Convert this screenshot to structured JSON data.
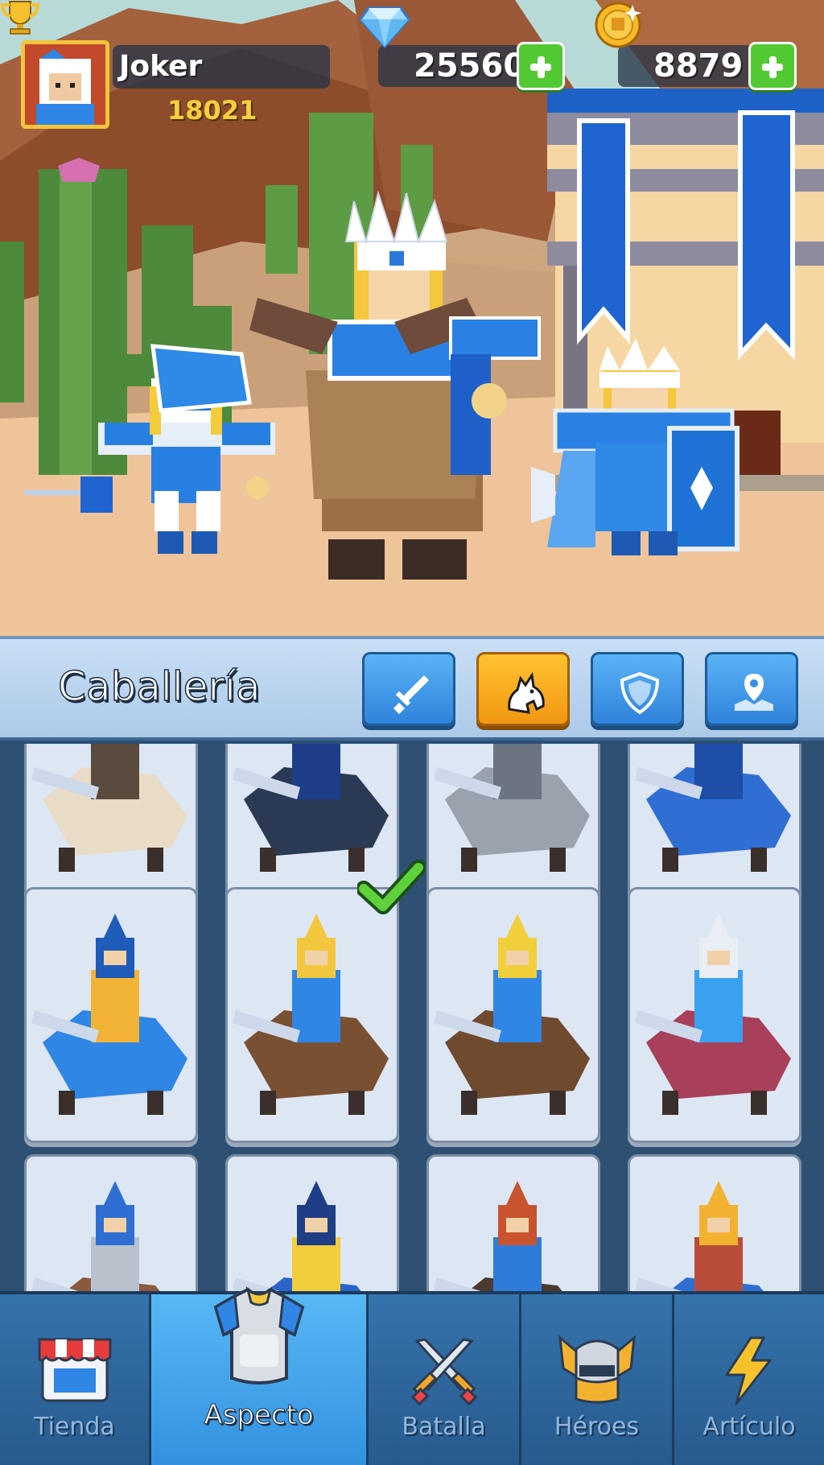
{
  "player": {
    "name": "Joker",
    "trophies": "18021"
  },
  "currency": {
    "gems": "25560",
    "coins": "8879"
  },
  "category": {
    "title": "Caballería",
    "tabs": [
      {
        "icon": "sword-icon",
        "active": false
      },
      {
        "icon": "horse-icon",
        "active": true
      },
      {
        "icon": "shield-icon",
        "active": false
      },
      {
        "icon": "map-pin-icon",
        "active": false
      }
    ]
  },
  "skins": {
    "selected_index": 5,
    "items": [
      {
        "icon": "white-beast-mount"
      },
      {
        "icon": "black-dragon-mount"
      },
      {
        "icon": "grey-wolf-mount"
      },
      {
        "icon": "blue-dragon-mount"
      },
      {
        "icon": "blue-bird-knight"
      },
      {
        "icon": "horned-beast-knight"
      },
      {
        "icon": "yellow-armored-knight"
      },
      {
        "icon": "boar-viking-rider"
      },
      {
        "icon": "grey-winged-rider"
      },
      {
        "icon": "blue-wyvern-rider"
      },
      {
        "icon": "red-hair-cavalier"
      },
      {
        "icon": "stag-wizard-rider"
      }
    ]
  },
  "nav": {
    "items": [
      {
        "label": "Tienda",
        "icon": "shop-icon"
      },
      {
        "label": "Aspecto",
        "icon": "armor-icon"
      },
      {
        "label": "Batalla",
        "icon": "crossed-swords-icon"
      },
      {
        "label": "Héroes",
        "icon": "helmet-icon"
      },
      {
        "label": "Artículo",
        "icon": "lightning-icon"
      }
    ],
    "active": "Aspecto"
  },
  "colors": {
    "accent_orange": "#f5a31a",
    "accent_blue": "#3a8fe6",
    "plus_green": "#52c932",
    "trophy_gold": "#f6cf3c"
  }
}
